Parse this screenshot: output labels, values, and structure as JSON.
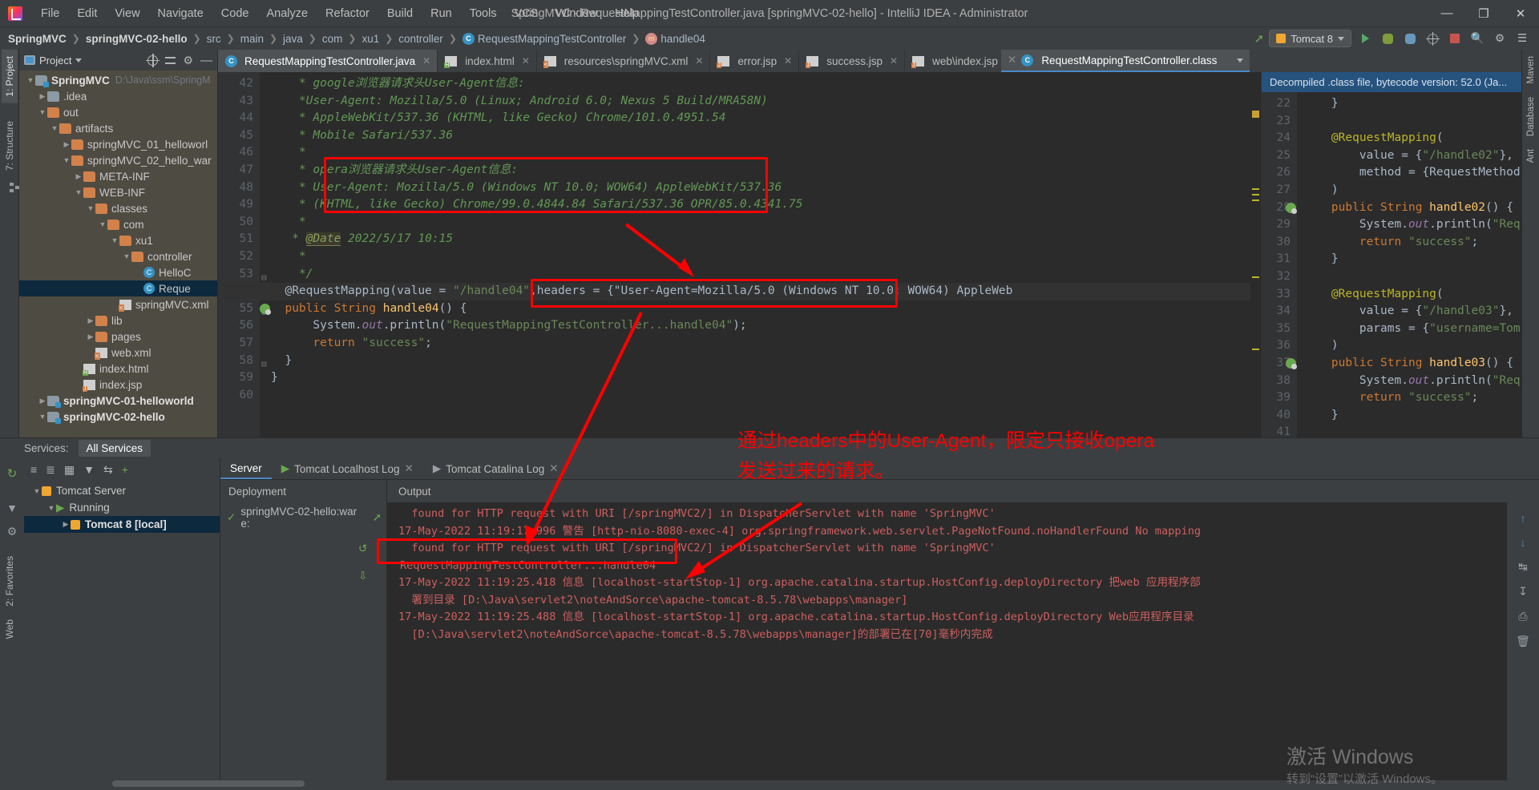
{
  "window": {
    "title": "SpringMVC - RequestMappingTestController.java [springMVC-02-hello] - IntelliJ IDEA - Administrator",
    "minimize": "—",
    "maximize": "❐",
    "close": "✕"
  },
  "menubar": [
    "File",
    "Edit",
    "View",
    "Navigate",
    "Code",
    "Analyze",
    "Refactor",
    "Build",
    "Run",
    "Tools",
    "VCS",
    "Window",
    "Help"
  ],
  "breadcrumb": [
    {
      "label": "SpringMVC",
      "bold": true
    },
    {
      "label": "springMVC-02-hello",
      "bold": true
    },
    {
      "label": "src",
      "bold": false
    },
    {
      "label": "main",
      "bold": false
    },
    {
      "label": "java",
      "bold": false
    },
    {
      "label": "com",
      "bold": false
    },
    {
      "label": "xu1",
      "bold": false
    },
    {
      "label": "controller",
      "bold": false
    },
    {
      "label": "RequestMappingTestController",
      "bold": false,
      "icon": "class-icon"
    },
    {
      "label": "handle04",
      "bold": false,
      "icon": "method-icon"
    }
  ],
  "toolbar": {
    "run_config": "Tomcat 8",
    "run_tooltip": "Run",
    "debug_tooltip": "Debug",
    "stop_tooltip": "Stop"
  },
  "project_panel": {
    "title": "Project",
    "tree": [
      {
        "depth": 0,
        "arrow": "▼",
        "icon": "folder-module",
        "label": "SpringMVC",
        "bold": true,
        "path": "D:\\Java\\ssm\\SpringM"
      },
      {
        "depth": 1,
        "arrow": "▶",
        "icon": "folder-grey",
        "label": ".idea"
      },
      {
        "depth": 1,
        "arrow": "▼",
        "icon": "folder",
        "label": "out"
      },
      {
        "depth": 2,
        "arrow": "▼",
        "icon": "folder",
        "label": "artifacts"
      },
      {
        "depth": 3,
        "arrow": "▶",
        "icon": "folder",
        "label": "springMVC_01_helloworl"
      },
      {
        "depth": 3,
        "arrow": "▼",
        "icon": "folder",
        "label": "springMVC_02_hello_war"
      },
      {
        "depth": 4,
        "arrow": "▶",
        "icon": "folder",
        "label": "META-INF"
      },
      {
        "depth": 4,
        "arrow": "▼",
        "icon": "folder",
        "label": "WEB-INF"
      },
      {
        "depth": 5,
        "arrow": "▼",
        "icon": "folder",
        "label": "classes"
      },
      {
        "depth": 6,
        "arrow": "▼",
        "icon": "folder",
        "label": "com"
      },
      {
        "depth": 7,
        "arrow": "▼",
        "icon": "folder",
        "label": "xu1"
      },
      {
        "depth": 8,
        "arrow": "▼",
        "icon": "folder",
        "label": "controller"
      },
      {
        "depth": 9,
        "arrow": "",
        "icon": "class",
        "label": "HelloC"
      },
      {
        "depth": 9,
        "arrow": "",
        "icon": "class",
        "label": "Reque",
        "selected": true
      },
      {
        "depth": 7,
        "arrow": "",
        "icon": "xml",
        "label": "springMVC.xml"
      },
      {
        "depth": 5,
        "arrow": "▶",
        "icon": "folder",
        "label": "lib"
      },
      {
        "depth": 5,
        "arrow": "▶",
        "icon": "folder",
        "label": "pages"
      },
      {
        "depth": 5,
        "arrow": "",
        "icon": "xml",
        "label": "web.xml"
      },
      {
        "depth": 4,
        "arrow": "",
        "icon": "html",
        "label": "index.html"
      },
      {
        "depth": 4,
        "arrow": "",
        "icon": "jsp",
        "label": "index.jsp"
      },
      {
        "depth": 1,
        "arrow": "▶",
        "icon": "folder-module",
        "label": "springMVC-01-helloworld",
        "bold": true
      },
      {
        "depth": 1,
        "arrow": "▼",
        "icon": "folder-module",
        "label": "springMVC-02-hello",
        "bold": true
      }
    ]
  },
  "editor_tabs": [
    {
      "label": "RequestMappingTestController.java",
      "icon": "java-class-icon",
      "active": true,
      "close": "✕"
    },
    {
      "label": "index.html",
      "icon": "html-icon",
      "active": false,
      "close": "✕"
    },
    {
      "label": "resources\\springMVC.xml",
      "icon": "xml-icon",
      "active": false,
      "close": "✕"
    },
    {
      "label": "error.jsp",
      "icon": "jsp-icon",
      "active": false,
      "close": "✕"
    },
    {
      "label": "success.jsp",
      "icon": "jsp-icon",
      "active": false,
      "close": "✕"
    },
    {
      "label": "web\\index.jsp",
      "icon": "jsp-icon",
      "active": false,
      "close": "✕",
      "more": "⋮",
      "chevron": "⌄"
    }
  ],
  "editor": {
    "first_line_number": 42,
    "lines": [
      {
        "n": 42,
        "text": " * google浏览器请求头User-Agent信息:",
        "type": "comment"
      },
      {
        "n": 43,
        "text": " *User-Agent: Mozilla/5.0 (Linux; Android 6.0; Nexus 5 Build/MRA58N)",
        "type": "comment"
      },
      {
        "n": 44,
        "text": " * AppleWebKit/537.36 (KHTML, like Gecko) Chrome/101.0.4951.54",
        "type": "comment"
      },
      {
        "n": 45,
        "text": " * Mobile Safari/537.36",
        "type": "comment"
      },
      {
        "n": 46,
        "text": " *",
        "type": "comment"
      },
      {
        "n": 47,
        "text": " * opera浏览器请求头User-Agent信息:",
        "type": "comment"
      },
      {
        "n": 48,
        "text": " * User-Agent: Mozilla/5.0 (Windows NT 10.0; WOW64) AppleWebKit/537.36",
        "type": "comment"
      },
      {
        "n": 49,
        "text": " * (KHTML, like Gecko) Chrome/99.0.4844.84 Safari/537.36 OPR/85.0.4341.75",
        "type": "comment"
      },
      {
        "n": 50,
        "text": " *",
        "type": "comment"
      },
      {
        "n": 51,
        "text": " * @Date 2022/5/17 10:15",
        "type": "comment-date"
      },
      {
        "n": 52,
        "text": " *",
        "type": "comment"
      },
      {
        "n": 53,
        "text": " */",
        "type": "comment"
      },
      {
        "n": 54,
        "text": "@RequestMapping(value = \"/handle04\",headers = {\"User-Agent=Mozilla/5.0 (Windows NT 10.0; WOW64) AppleWeb",
        "type": "annotation"
      },
      {
        "n": 55,
        "text": "public String handle04() {",
        "type": "code"
      },
      {
        "n": 56,
        "text": "    System.out.println(\"RequestMappingTestController...handle04\");",
        "type": "code"
      },
      {
        "n": 57,
        "text": "    return \"success\";",
        "type": "code"
      },
      {
        "n": 58,
        "text": "}",
        "type": "code"
      },
      {
        "n": 59,
        "text": "}",
        "type": "code"
      },
      {
        "n": 60,
        "text": "",
        "type": "code"
      }
    ]
  },
  "decompiled": {
    "banner": "Decompiled .class file, bytecode version: 52.0 (Ja...",
    "tab_label": "RequestMappingTestController.class",
    "lines": [
      {
        "n": 22,
        "text": "    }"
      },
      {
        "n": 23,
        "text": ""
      },
      {
        "n": 24,
        "text": "    @RequestMapping("
      },
      {
        "n": 25,
        "text": "        value = {\"/handle02\"},"
      },
      {
        "n": 26,
        "text": "        method = {RequestMethod."
      },
      {
        "n": 27,
        "text": "    )"
      },
      {
        "n": 28,
        "text": "    public String handle02() {"
      },
      {
        "n": 29,
        "text": "        System.out.println(\"Requ"
      },
      {
        "n": 30,
        "text": "        return \"success\";"
      },
      {
        "n": 31,
        "text": "    }"
      },
      {
        "n": 32,
        "text": ""
      },
      {
        "n": 33,
        "text": "    @RequestMapping("
      },
      {
        "n": 34,
        "text": "        value = {\"/handle03\"},"
      },
      {
        "n": 35,
        "text": "        params = {\"username=Tom"
      },
      {
        "n": 36,
        "text": "    )"
      },
      {
        "n": 37,
        "text": "    public String handle03() {"
      },
      {
        "n": 38,
        "text": "        System.out.println(\"Requ"
      },
      {
        "n": 39,
        "text": "        return \"success\";"
      },
      {
        "n": 40,
        "text": "    }"
      },
      {
        "n": 41,
        "text": ""
      }
    ]
  },
  "services": {
    "label": "Services:",
    "all_services_tab": "All Services",
    "tree": [
      {
        "depth": 0,
        "arrow": "▼",
        "icon": "tomcat-icon",
        "label": "Tomcat Server"
      },
      {
        "depth": 1,
        "arrow": "▼",
        "icon": "run-icon",
        "label": "Running"
      },
      {
        "depth": 2,
        "arrow": "▶",
        "icon": "tomcat-icon",
        "label": "Tomcat 8 [local]",
        "selected": true,
        "bold": true
      }
    ],
    "tabs": [
      {
        "label": "Server",
        "active": true
      },
      {
        "label": "Tomcat Localhost Log",
        "active": false,
        "close": "✕"
      },
      {
        "label": "Tomcat Catalina Log",
        "active": false,
        "close": "✕"
      }
    ],
    "deployment_title": "Deployment",
    "deployment_item": "springMVC-02-hello:war e:",
    "output_title": "Output",
    "console_lines": [
      "  found for HTTP request with URI [/springMVC2/] in DispatcherServlet with name 'SpringMVC'",
      "17-May-2022 11:19:17.996 警告 [http-nio-8080-exec-4] org.springframework.web.servlet.PageNotFound.noHandlerFound No mapping",
      "  found for HTTP request with URI [/springMVC2/] in DispatcherServlet with name 'SpringMVC'",
      "RequestMappingTestController...handle04",
      "17-May-2022 11:19:25.418 信息 [localhost-startStop-1] org.apache.catalina.startup.HostConfig.deployDirectory 把web 应用程序部",
      "  署到目录 [D:\\Java\\servlet2\\noteAndSorce\\apache-tomcat-8.5.78\\webapps\\manager]",
      "17-May-2022 11:19:25.488 信息 [localhost-startStop-1] org.apache.catalina.startup.HostConfig.deployDirectory Web应用程序目录",
      "  [D:\\Java\\servlet2\\noteAndSorce\\apache-tomcat-8.5.78\\webapps\\manager]的部署已在[70]毫秒内完成"
    ]
  },
  "left_strip": {
    "project_tab": "1: Project",
    "structure_tab": "7: Structure",
    "favorites_tab": "2: Favorites",
    "web_tab": "Web"
  },
  "right_strip": {
    "maven_tab": "Maven",
    "database_tab": "Database",
    "ant_tab": "Ant"
  },
  "annotations": {
    "note_line1": "通过headers中的User-Agent，限定只接收opera",
    "note_line2": "发送过来的请求。",
    "highlight_color": "#fe0000"
  },
  "watermark": {
    "line1": "激活 Windows",
    "line2": "转到“设置”以激活 Windows。"
  }
}
